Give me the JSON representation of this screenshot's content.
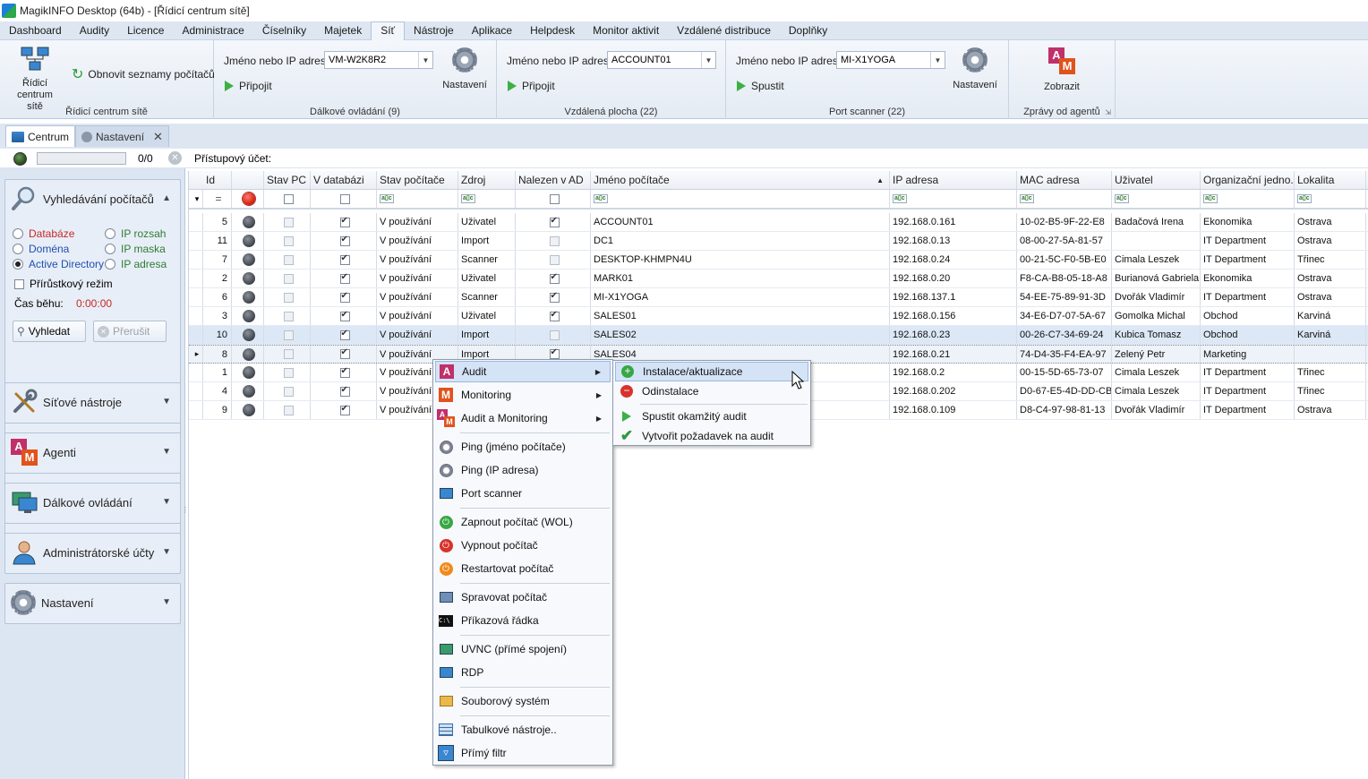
{
  "window": {
    "title": "MagikINFO Desktop (64b) - [Řídicí centrum sítě]"
  },
  "menu": {
    "tabs": [
      "Dashboard",
      "Audity",
      "Licence",
      "Administrace",
      "Číselníky",
      "Majetek",
      "Síť",
      "Nástroje",
      "Aplikace",
      "Helpdesk",
      "Monitor aktivit",
      "Vzdálené distribuce",
      "Doplňky"
    ],
    "active": "Síť"
  },
  "ribbon": {
    "control_center": {
      "big_button": "Řídicí centrum sítě",
      "refresh_label": "Obnovit seznamy počítačů",
      "group_label": "Řídicí centrum sítě"
    },
    "remote_control": {
      "field_label": "Jméno nebo IP adresa:",
      "value": "VM-W2K8R2",
      "connect_label": "Připojit",
      "settings_label": "Nastavení",
      "group_label": "Dálkové ovládání (9)"
    },
    "remote_desktop": {
      "field_label": "Jméno nebo IP adresa:",
      "value": "ACCOUNT01",
      "connect_label": "Připojit",
      "group_label": "Vzdálená plocha (22)"
    },
    "port_scanner": {
      "field_label": "Jméno nebo IP adresa:",
      "value": "MI-X1YOGA",
      "run_label": "Spustit",
      "settings_label": "Nastavení",
      "group_label": "Port scanner (22)"
    },
    "agent_messages": {
      "show_label": "Zobrazit",
      "group_label": "Zprávy od agentů"
    }
  },
  "doc_tabs": [
    {
      "label": "Centrum"
    },
    {
      "label": "Nastavení"
    }
  ],
  "status": {
    "progress_text": "0/0",
    "account_label": "Přístupový účet:"
  },
  "left_panel": {
    "search": {
      "title": "Vyhledávání počítačů",
      "options": [
        "Databáze",
        "Doména",
        "Active Directory",
        "IP rozsah",
        "IP maska",
        "IP adresa"
      ],
      "selected": "Active Directory",
      "incremental_label": "Přírůstkový režim",
      "runtime_label": "Čas běhu:",
      "runtime_value": "0:00:00",
      "search_button": "Vyhledat",
      "stop_button": "Přerušit"
    },
    "sections": [
      "Síťové nástroje",
      "Agenti",
      "Dálkové ovládání",
      "Administrátorské účty",
      "Nastavení"
    ]
  },
  "table": {
    "headers": [
      "Id",
      "",
      "Stav PC",
      "V databázi",
      "Stav počítače",
      "Zdroj",
      "Nalezen v AD",
      "Jméno počítače",
      "IP adresa",
      "MAC adresa",
      "Uživatel",
      "Organizační jedno...",
      "Lokalita"
    ],
    "filter_eq": "=",
    "rows": [
      {
        "id": "5",
        "indb": true,
        "state": "V používání",
        "src": "Uživatel",
        "ad": true,
        "name": "ACCOUNT01",
        "ip": "192.168.0.161",
        "mac": "10-02-B5-9F-22-E8",
        "user": "Badačová Irena",
        "org": "Ekonomika",
        "loc": "Ostrava"
      },
      {
        "id": "11",
        "indb": true,
        "state": "V používání",
        "src": "Import",
        "ad": false,
        "name": "DC1",
        "ip": "192.168.0.13",
        "mac": "08-00-27-5A-81-57",
        "user": "",
        "org": "IT Department",
        "loc": "Ostrava"
      },
      {
        "id": "7",
        "indb": true,
        "state": "V používání",
        "src": "Scanner",
        "ad": false,
        "name": "DESKTOP-KHMPN4U",
        "ip": "192.168.0.24",
        "mac": "00-21-5C-F0-5B-E0",
        "user": "Cimala Leszek",
        "org": "IT Department",
        "loc": "Třinec"
      },
      {
        "id": "2",
        "indb": true,
        "state": "V používání",
        "src": "Uživatel",
        "ad": true,
        "name": "MARK01",
        "ip": "192.168.0.20",
        "mac": "F8-CA-B8-05-18-A8",
        "user": "Burianová Gabriela",
        "org": "Ekonomika",
        "loc": "Ostrava"
      },
      {
        "id": "6",
        "indb": true,
        "state": "V používání",
        "src": "Scanner",
        "ad": true,
        "name": "MI-X1YOGA",
        "ip": "192.168.137.1",
        "mac": "54-EE-75-89-91-3D",
        "user": "Dvořák Vladimír",
        "org": "IT Department",
        "loc": "Ostrava"
      },
      {
        "id": "3",
        "indb": true,
        "state": "V používání",
        "src": "Uživatel",
        "ad": true,
        "name": "SALES01",
        "ip": "192.168.0.156",
        "mac": "34-E6-D7-07-5A-67",
        "user": "Gomolka Michal",
        "org": "Obchod",
        "loc": "Karviná"
      },
      {
        "id": "10",
        "indb": true,
        "state": "V používání",
        "src": "Import",
        "ad": false,
        "name": "SALES02",
        "ip": "192.168.0.23",
        "mac": "00-26-C7-34-69-24",
        "user": "Kubica Tomasz",
        "org": "Obchod",
        "loc": "Karviná"
      },
      {
        "id": "8",
        "indb": true,
        "state": "V používání",
        "src": "Import",
        "ad": true,
        "name": "SALES04",
        "ip": "192.168.0.21",
        "mac": "74-D4-35-F4-EA-97",
        "user": "Zelený Petr",
        "org": "Marketing",
        "loc": ""
      },
      {
        "id": "1",
        "indb": true,
        "state": "V používání",
        "src": "",
        "ad": false,
        "name": "",
        "ip": "192.168.0.2",
        "mac": "00-15-5D-65-73-07",
        "user": "Cimala Leszek",
        "org": "IT Department",
        "loc": "Třinec"
      },
      {
        "id": "4",
        "indb": true,
        "state": "V používání",
        "src": "",
        "ad": false,
        "name": "",
        "ip": "192.168.0.202",
        "mac": "D0-67-E5-4D-DD-CB",
        "user": "Cimala Leszek",
        "org": "IT Department",
        "loc": "Třinec"
      },
      {
        "id": "9",
        "indb": true,
        "state": "V používání",
        "src": "",
        "ad": false,
        "name": "",
        "ip": "192.168.0.109",
        "mac": "D8-C4-97-98-81-13",
        "user": "Dvořák Vladimír",
        "org": "IT Department",
        "loc": "Ostrava"
      }
    ]
  },
  "context_menu": {
    "items": [
      "Audit",
      "Monitoring",
      "Audit a Monitoring",
      "Ping (jméno počítače)",
      "Ping (IP adresa)",
      "Port scanner",
      "Zapnout počítač (WOL)",
      "Vypnout počítač",
      "Restartovat počítač",
      "Spravovat počítač",
      "Příkazová řádka",
      "UVNC (přímé spojení)",
      "RDP",
      "Souborový systém",
      "Tabulkové nástroje..",
      "Přímý filtr"
    ],
    "submenu": [
      "Instalace/aktualizace",
      "Odinstalace",
      "Spustit okamžitý audit",
      "Vytvořit požadavek na audit"
    ]
  },
  "icons": {
    "a_letter": "A",
    "m_letter": "M",
    "cmd": "C:\\"
  },
  "colors": {
    "accent": "#2f6fb6",
    "link_red": "#c62828",
    "link_blue": "#1f4fb0",
    "link_green": "#2e7d32"
  }
}
